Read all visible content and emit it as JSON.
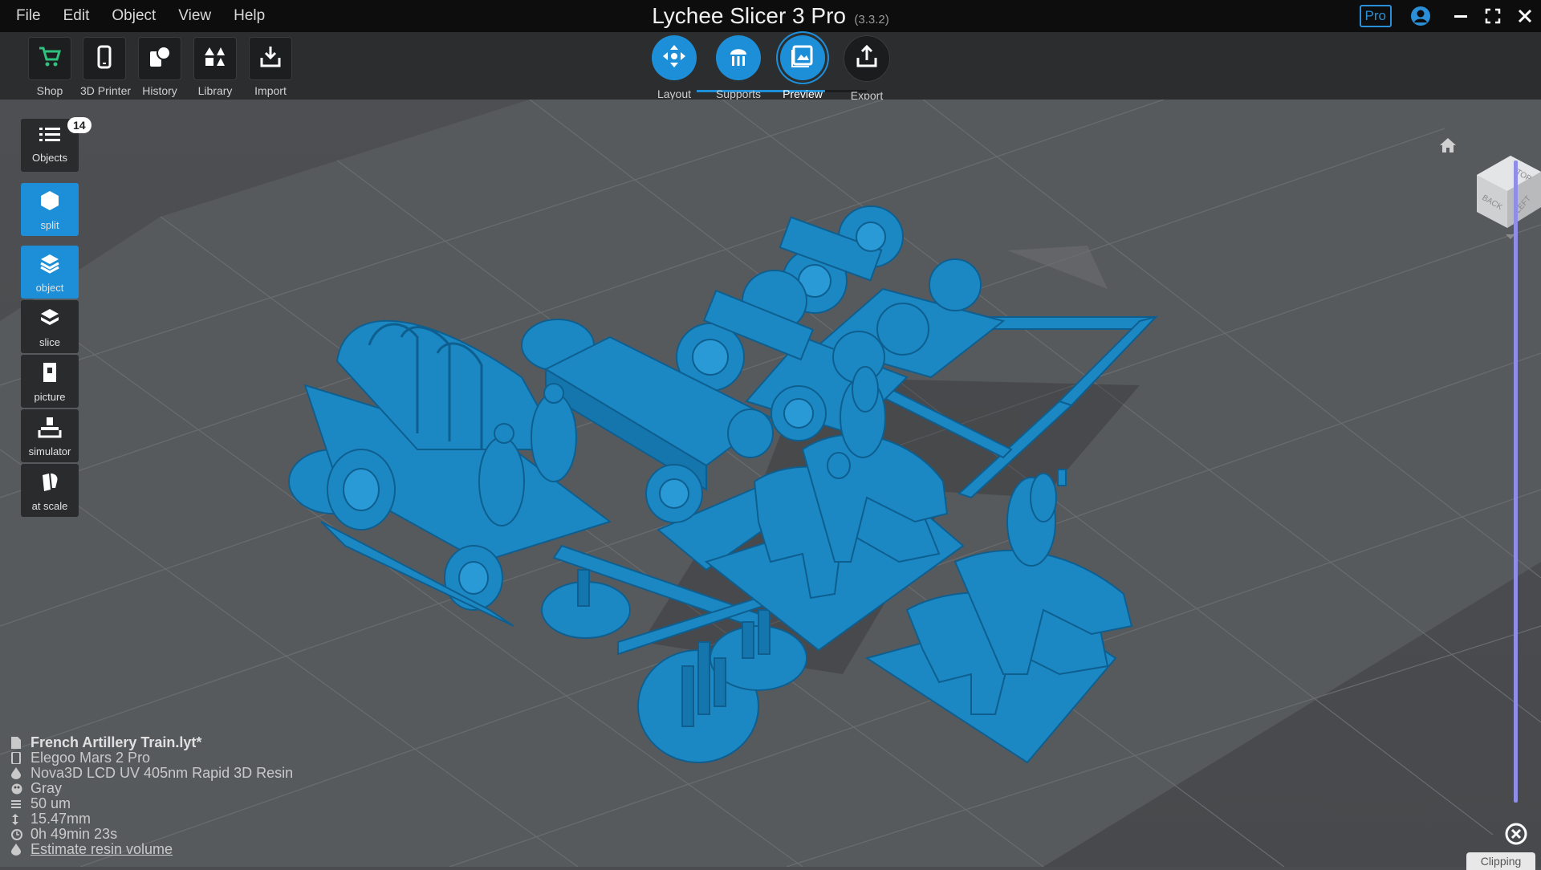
{
  "menu": [
    "File",
    "Edit",
    "Object",
    "View",
    "Help"
  ],
  "app": {
    "title": "Lychee Slicer 3 Pro",
    "version": "(3.3.2)",
    "pro_badge": "Pro"
  },
  "toolbar": {
    "tools": [
      {
        "label": "Shop",
        "icon": "cart-icon"
      },
      {
        "label": "3D Printer",
        "icon": "phone-printer-icon"
      },
      {
        "label": "History",
        "icon": "history-icon"
      },
      {
        "label": "Library",
        "icon": "library-icon"
      },
      {
        "label": "Import",
        "icon": "import-icon"
      }
    ],
    "steps": [
      {
        "label": "Layout",
        "icon": "move-arrows-icon"
      },
      {
        "label": "Supports",
        "icon": "supports-icon"
      },
      {
        "label": "Preview",
        "icon": "preview-icon",
        "active": true
      },
      {
        "label": "Export",
        "icon": "export-icon"
      }
    ]
  },
  "sidebar": {
    "objects_label": "Objects",
    "objects_count": "14",
    "items": [
      {
        "label": "split",
        "icon": "hexagon-icon",
        "active": true
      },
      {
        "label": "object",
        "icon": "layers-icon",
        "active": true
      },
      {
        "label": "slice",
        "icon": "slice-icon",
        "active": false
      },
      {
        "label": "picture",
        "icon": "picture-icon",
        "active": false
      },
      {
        "label": "simulator",
        "icon": "simulator-icon",
        "active": false
      },
      {
        "label": "at scale",
        "icon": "at-scale-icon",
        "active": false
      }
    ]
  },
  "info": {
    "file": "French Artillery Train.lyt*",
    "printer": "Elegoo Mars 2 Pro",
    "resin": "Nova3D LCD UV 405nm Rapid 3D Resin",
    "color": "Gray",
    "layer": "50 um",
    "height": "15.47mm",
    "time": "0h 49min 23s",
    "estimate_link": "Estimate resin volume"
  },
  "view_cube": {
    "faces": [
      "TOP",
      "BACK",
      "LEFT"
    ]
  },
  "clipping_label": "Clipping",
  "colors": {
    "accent": "#1d8fd8",
    "model": "#1b88c4",
    "background": "#4a4c4f"
  }
}
